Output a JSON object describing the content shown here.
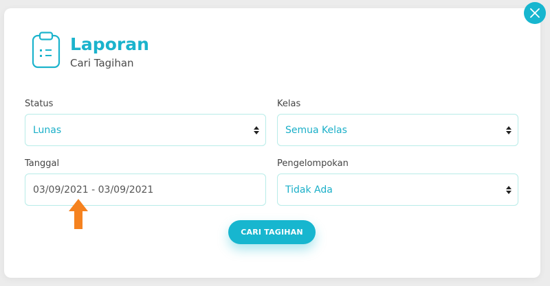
{
  "header": {
    "title": "Laporan",
    "subtitle": "Cari Tagihan"
  },
  "form": {
    "status": {
      "label": "Status",
      "value": "Lunas"
    },
    "kelas": {
      "label": "Kelas",
      "value": "Semua Kelas"
    },
    "tanggal": {
      "label": "Tanggal",
      "value": "03/09/2021 - 03/09/2021"
    },
    "pengelompokan": {
      "label": "Pengelompokan",
      "value": "Tidak Ada"
    }
  },
  "actions": {
    "search_label": "CARI TAGIHAN"
  },
  "icons": {
    "close": "close-icon",
    "report": "clipboard-icon",
    "annotation": "arrow-up-icon",
    "select": "select-arrows-icon"
  },
  "colors": {
    "accent": "#17b6cf",
    "field_border": "#b7ece8",
    "annotation": "#f5821f"
  }
}
